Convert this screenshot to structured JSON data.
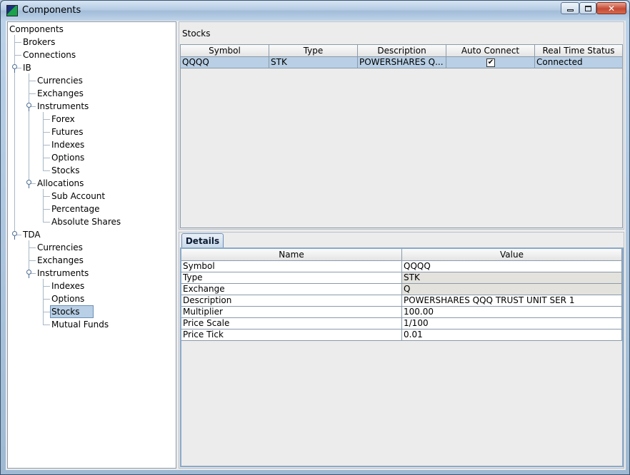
{
  "window": {
    "title": "Components"
  },
  "tree": {
    "nodes": [
      {
        "label": "Components"
      },
      {
        "label": "Brokers"
      },
      {
        "label": "Connections"
      },
      {
        "label": "IB"
      },
      {
        "label": "Currencies"
      },
      {
        "label": "Exchanges"
      },
      {
        "label": "Instruments"
      },
      {
        "label": "Forex"
      },
      {
        "label": "Futures"
      },
      {
        "label": "Indexes"
      },
      {
        "label": "Options"
      },
      {
        "label": "Stocks"
      },
      {
        "label": "Allocations"
      },
      {
        "label": "Sub Account"
      },
      {
        "label": "Percentage"
      },
      {
        "label": "Absolute Shares"
      },
      {
        "label": "TDA"
      },
      {
        "label": "Currencies"
      },
      {
        "label": "Exchanges"
      },
      {
        "label": "Instruments"
      },
      {
        "label": "Indexes"
      },
      {
        "label": "Options"
      },
      {
        "label": "Stocks"
      },
      {
        "label": "Mutual Funds"
      }
    ],
    "selected": "TDA / Instruments / Stocks"
  },
  "stocks": {
    "title": "Stocks",
    "columns": [
      "Symbol",
      "Type",
      "Description",
      "Auto Connect",
      "Real Time Status"
    ],
    "rows": [
      {
        "symbol": "QQQQ",
        "type": "STK",
        "description": "POWERSHARES Q...",
        "auto_connect": true,
        "check_mark": "✔",
        "status": "Connected"
      }
    ]
  },
  "details": {
    "tab_label": "Details",
    "columns": [
      "Name",
      "Value"
    ],
    "rows": [
      {
        "name": "Symbol",
        "value": "QQQQ",
        "readonly": false
      },
      {
        "name": "Type",
        "value": "STK",
        "readonly": true
      },
      {
        "name": "Exchange",
        "value": "Q",
        "readonly": true
      },
      {
        "name": "Description",
        "value": "POWERSHARES QQQ TRUST UNIT SER 1",
        "readonly": false
      },
      {
        "name": "Multiplier",
        "value": "100.00",
        "readonly": false
      },
      {
        "name": "Price Scale",
        "value": "1/100",
        "readonly": false
      },
      {
        "name": "Price Tick",
        "value": "0.01",
        "readonly": false
      }
    ]
  }
}
